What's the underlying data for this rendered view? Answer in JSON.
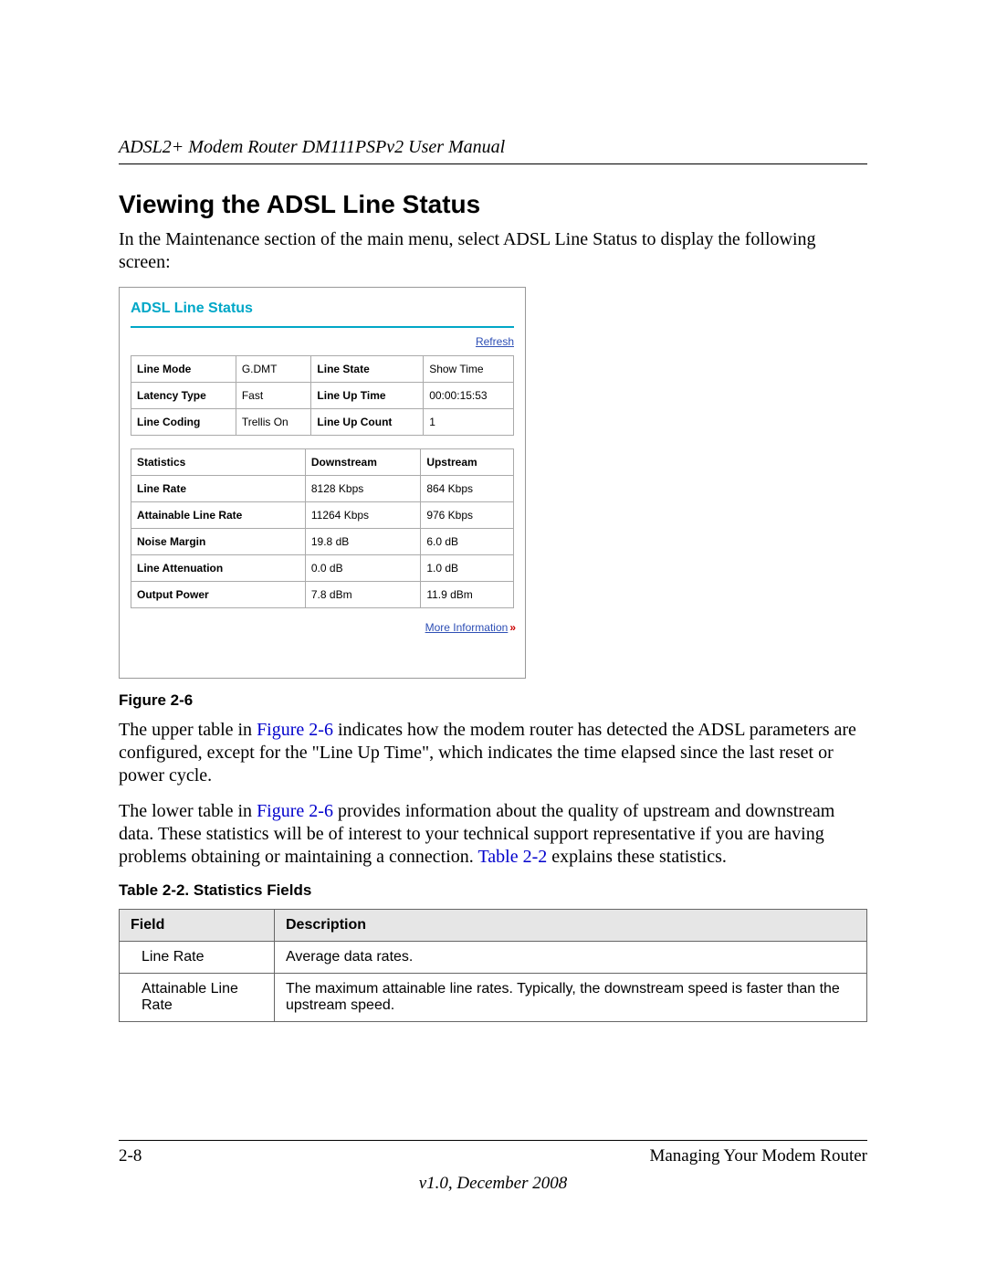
{
  "header": {
    "running": "ADSL2+ Modem Router DM111PSPv2 User Manual"
  },
  "section": {
    "title": "Viewing the ADSL Line Status",
    "intro": "In the Maintenance section of the main menu, select ADSL Line Status to display the following screen:"
  },
  "screenshot": {
    "title": "ADSL Line Status",
    "refresh": "Refresh",
    "more_info": "More Information",
    "top": {
      "r1c1l": "Line Mode",
      "r1c1v": "G.DMT",
      "r1c2l": "Line State",
      "r1c2v": "Show Time",
      "r2c1l": "Latency Type",
      "r2c1v": "Fast",
      "r2c2l": "Line Up Time",
      "r2c2v": "00:00:15:53",
      "r3c1l": "Line Coding",
      "r3c1v": "Trellis On",
      "r3c2l": "Line Up Count",
      "r3c2v": "1"
    },
    "stats": {
      "h1": "Statistics",
      "h2": "Downstream",
      "h3": "Upstream",
      "r1l": "Line Rate",
      "r1d": "8128 Kbps",
      "r1u": "864 Kbps",
      "r2l": "Attainable Line Rate",
      "r2d": "11264 Kbps",
      "r2u": "976 Kbps",
      "r3l": "Noise Margin",
      "r3d": "19.8 dB",
      "r3u": "6.0 dB",
      "r4l": "Line Attenuation",
      "r4d": "0.0 dB",
      "r4u": "1.0 dB",
      "r5l": "Output Power",
      "r5d": "7.8 dBm",
      "r5u": "11.9 dBm"
    }
  },
  "fig_caption": "Figure 2-6",
  "para1": {
    "a": "The upper table in ",
    "ref": "Figure 2-6",
    "b": " indicates how the modem router has detected the ADSL parameters are configured, except for the \"Line Up Time\", which indicates the time elapsed since the last reset or power cycle."
  },
  "para2": {
    "a": "The lower table in ",
    "ref1": "Figure 2-6",
    "b": " provides information about the quality of upstream and downstream data. These statistics will be of interest to your technical support representative if you are having problems obtaining or maintaining a connection. ",
    "ref2": "Table 2-2",
    "c": " explains these statistics."
  },
  "tbl_caption": "Table 2-2.   Statistics Fields",
  "doc_table": {
    "h1": "Field",
    "h2": "Description",
    "r1f": "Line Rate",
    "r1d": "Average data rates.",
    "r2f": "Attainable Line Rate",
    "r2d": "The maximum attainable line rates. Typically, the downstream speed is faster than the upstream speed."
  },
  "footer": {
    "page": "2-8",
    "chapter": "Managing Your Modem Router",
    "version": "v1.0, December 2008"
  }
}
